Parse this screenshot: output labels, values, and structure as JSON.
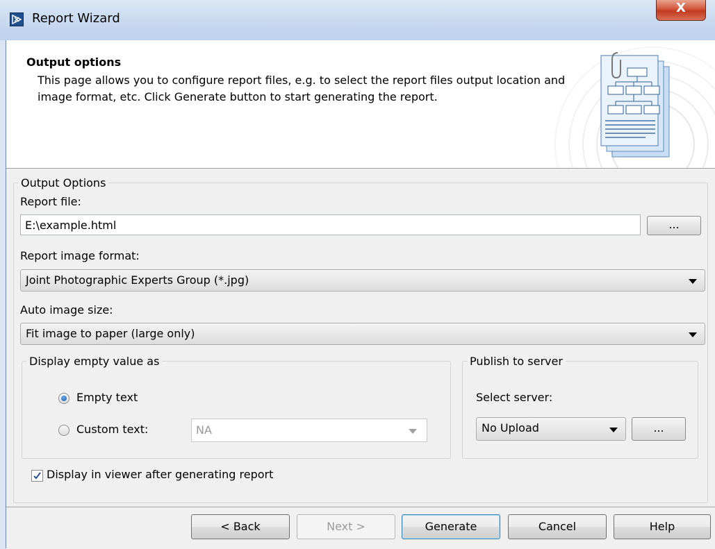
{
  "window": {
    "title": "Report Wizard"
  },
  "header": {
    "title": "Output options",
    "description": "This page allows you to configure report files, e.g. to select the report files output location and image format, etc. Click Generate button to start generating the report."
  },
  "output_options": {
    "legend": "Output Options",
    "report_file_label": "Report file:",
    "report_file_value": "E:\\example.html",
    "browse_label": "...",
    "image_format_label": "Report image format:",
    "image_format_value": "Joint Photographic Experts Group (*.jpg)",
    "auto_size_label": "Auto image size:",
    "auto_size_value": "Fit image to paper (large only)"
  },
  "empty_value": {
    "legend": "Display empty value as",
    "empty_text_label": "Empty text",
    "custom_text_label": "Custom text:",
    "custom_text_value": "NA",
    "selected": "empty_text"
  },
  "publish": {
    "legend": "Publish to server",
    "select_label": "Select server:",
    "server_value": "No Upload",
    "browse_label": "..."
  },
  "display_in_viewer": {
    "label": "Display in viewer after generating report",
    "checked": true
  },
  "buttons": {
    "back": "< Back",
    "next": "Next >",
    "generate": "Generate",
    "cancel": "Cancel",
    "help": "Help"
  },
  "close_glyph": "X"
}
